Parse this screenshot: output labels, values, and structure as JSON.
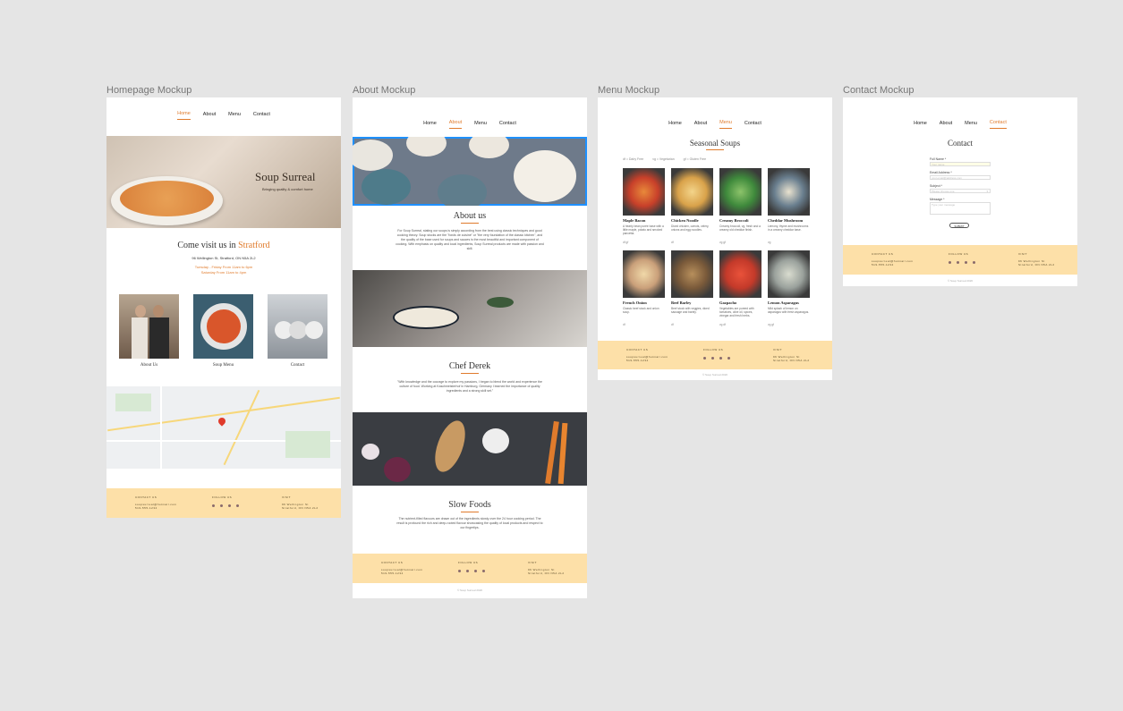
{
  "frames": {
    "home_label": "Homepage Mockup",
    "about_label": "About Mockup",
    "menu_label": "Menu Mockup",
    "contact_label": "Contact Mockup"
  },
  "nav": {
    "home": "Home",
    "about": "About",
    "menu": "Menu",
    "contact": "Contact"
  },
  "home": {
    "hero_title": "Soup Surreal",
    "hero_subtitle": "Bringing quality & comfort home",
    "visit_prefix": "Come visit us in ",
    "visit_city": "Stratford",
    "address": "96 Wellington St, Stratford, ON N5A 2L2",
    "hours_1": "Tuesday - Friday From 11am to 6pm",
    "hours_2": "Saturday From 11am to 4pm",
    "card_about": "About Us",
    "card_menu": "Soup Menu",
    "card_contact": "Contact"
  },
  "about": {
    "title": "About us",
    "body": "For Soup Surreal, stating our soups is simply according from the best using classic techniques and good cooking theory. Soup stocks are the \"fonds de cuisine\" or \"the very foundation of the classic kitchen\", and the quality of the base used for soups and sauces is the most beautiful and important component of cooking. With emphasis on quality and local ingredients, Soup Surreal products are made with passion and skill.",
    "chef_title": "Chef Derek",
    "chef_body": "\"With knowledge and the courage to explore my passions, I began to blend the world and experience the culture of food. Working at Kaschmeisterhof in Hamburg, Germany I learned the importance of quality ingredients and a strong skill set.\"",
    "slow_title": "Slow Foods",
    "slow_body": "The nutrient-filled flavours are drawn out of the ingredients slowly over the 24 hour cooking period. The result is profound the rich and deep-rooted flavour showcasing the quality of local products and respect to our fingertips."
  },
  "menu": {
    "title": "Seasonal Soups",
    "legend_df": "df = Dairy Free",
    "legend_vg": "vg = Vegetarian",
    "legend_gf": "gf = Gluten Free",
    "soups": [
      {
        "name": "Maple Bacon",
        "desc": "A hearty bean purée base with a little maple, potato and smoked pancetta.",
        "tags": "df  gf"
      },
      {
        "name": "Chicken Noodle",
        "desc": "Diced chicken, carrots, celery, onions and egg noodles.",
        "tags": "df"
      },
      {
        "name": "Creamy Broccoli",
        "desc": "Creamy broccoli, vg, fresh and a creamy old cheddar finish.",
        "tags": "vg  gf"
      },
      {
        "name": "Cheddar Mushroom",
        "desc": "Lemony, thyme and mushrooms in a creamy cheddar base.",
        "tags": "vg"
      },
      {
        "name": "French Onion",
        "desc": "Classic beef stock and onion soup.",
        "tags": "df"
      },
      {
        "name": "Beef Barley",
        "desc": "Beef stock with veggies, diced sausage and barley.",
        "tags": "df"
      },
      {
        "name": "Gazpacho",
        "desc": "Vegetables are pureed with tomatoes, olive oil, spices, vinegar and fresh herbs.",
        "tags": "vg  df"
      },
      {
        "name": "Lemon Asparagus",
        "desc": "Mild splash of lemon on asparagus with fresh asparagus.",
        "tags": "vg  gf"
      }
    ]
  },
  "contact": {
    "title": "Contact",
    "full_name": "Full Name *",
    "full_name_ph": "Your name",
    "email": "Email Address *",
    "email_ph": "your.email@address.com",
    "subject": "Subject *",
    "subject_value": "Please choose one",
    "message": "Message *",
    "message_ph": "Type your message",
    "submit": "SUBMIT"
  },
  "footer": {
    "contact_us": "CONTACT US",
    "follow_us": "FOLLOW US",
    "visit": "VISIT",
    "email": "soupsurreal@hotmail.com",
    "phone": "519-555-1234",
    "street": "96 Wellington St",
    "city": "Stratford, ON N5A 2L2",
    "copyright": "© Soup Surreal 2020"
  },
  "colors": {
    "accent": "#e07b2c",
    "footer": "#fde0a8",
    "selection": "#1e90ff"
  }
}
